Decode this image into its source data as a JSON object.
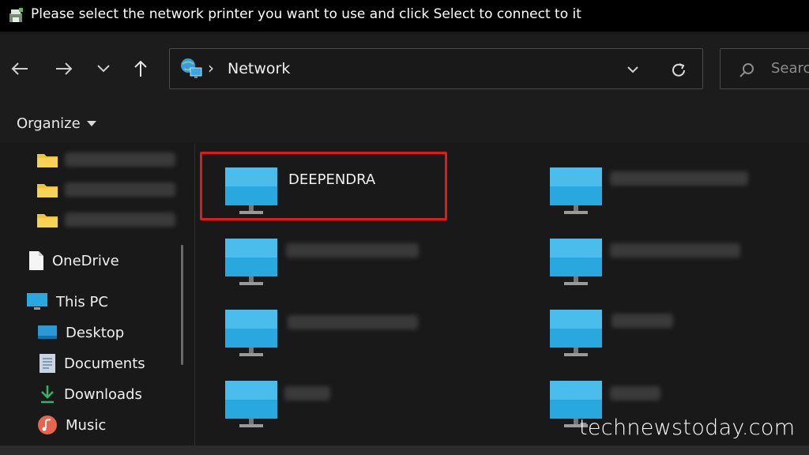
{
  "dialog": {
    "title": "Please select the network printer you want to use and click Select to connect to it"
  },
  "address": {
    "path": "Network",
    "separator": "›"
  },
  "search": {
    "placeholder": "Searc"
  },
  "toolbar": {
    "organize_label": "Organize"
  },
  "sidebar": {
    "items": [
      {
        "label": "",
        "icon": "folder-icon",
        "blurred": true
      },
      {
        "label": "",
        "icon": "folder-icon",
        "blurred": true
      },
      {
        "label": "",
        "icon": "folder-icon",
        "blurred": true
      },
      {
        "label": "OneDrive",
        "icon": "document-icon"
      },
      {
        "label": "This PC",
        "icon": "computer-icon"
      },
      {
        "label": "Desktop",
        "icon": "desktop-icon"
      },
      {
        "label": "Documents",
        "icon": "documents-icon"
      },
      {
        "label": "Downloads",
        "icon": "download-icon"
      },
      {
        "label": "Music",
        "icon": "music-icon"
      }
    ]
  },
  "network": {
    "computers": [
      {
        "name": "DEEPENDRA",
        "selected": true
      },
      {
        "name": "",
        "blurred": true
      },
      {
        "name": "",
        "blurred": true
      },
      {
        "name": "",
        "blurred": true
      },
      {
        "name": "",
        "blurred": true
      },
      {
        "name": "",
        "blurred": true
      },
      {
        "name": "",
        "blurred": true
      },
      {
        "name": "",
        "blurred": true
      }
    ]
  },
  "watermark": "technewstoday.com",
  "colors": {
    "highlight": "#e01b1b",
    "monitor": "#29a8e0",
    "folder": "#f4c430"
  }
}
